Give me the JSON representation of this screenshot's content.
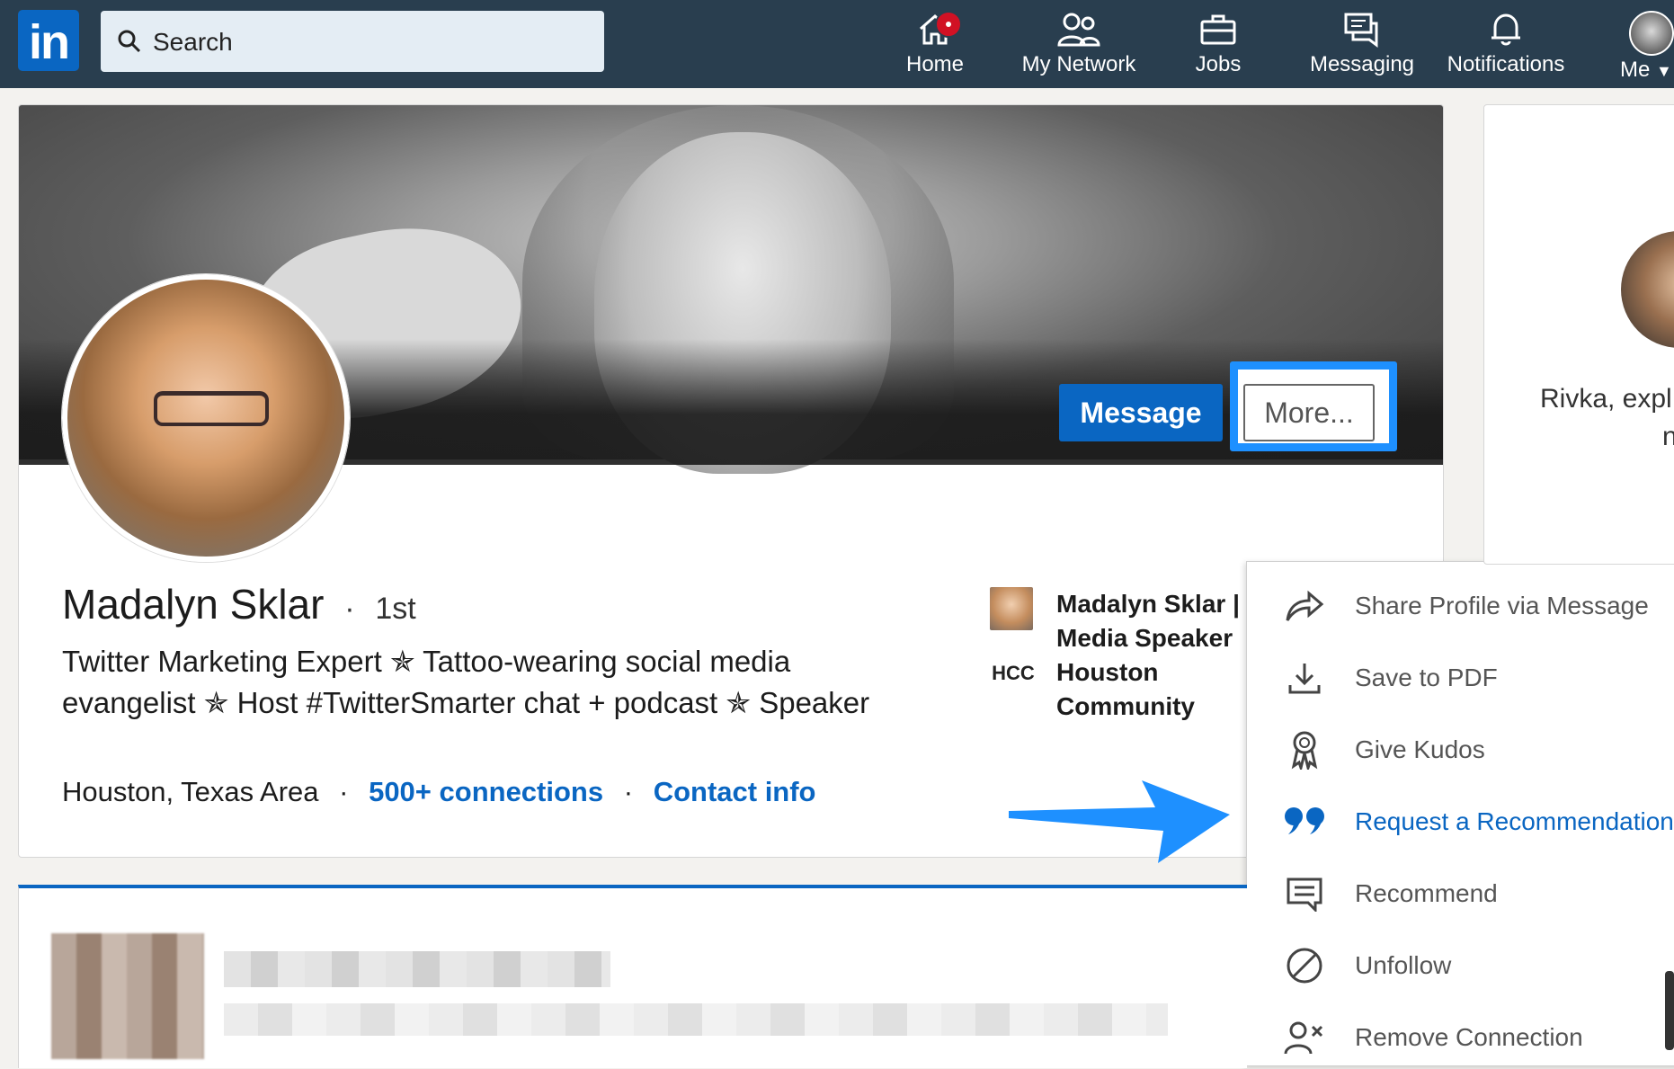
{
  "topbar": {
    "logo": "in",
    "search_placeholder": "Search",
    "nav": [
      {
        "label": "Home",
        "icon": "home-icon",
        "has_badge": true
      },
      {
        "label": "My Network",
        "icon": "network-icon"
      },
      {
        "label": "Jobs",
        "icon": "briefcase-icon"
      },
      {
        "label": "Messaging",
        "icon": "messaging-icon"
      },
      {
        "label": "Notifications",
        "icon": "bell-icon"
      },
      {
        "label": "Me",
        "icon": "avatar-icon"
      }
    ]
  },
  "profile": {
    "name": "Madalyn Sklar",
    "degree_separator": "·",
    "degree": "1st",
    "headline": "Twitter Marketing Expert ✯ Tattoo-wearing social media evangelist ✯ Host #TwitterSmarter chat + podcast ✯ Speaker",
    "location": "Houston, Texas Area",
    "meta_separator": "·",
    "connections": "500+ connections",
    "contact": "Contact info",
    "message_button": "Message",
    "more_button": "More...",
    "experience": [
      {
        "text": "Madalyn Sklar | Media Speaker &"
      },
      {
        "logo_text": "HCC",
        "text": "Houston Community College"
      }
    ]
  },
  "dropdown": {
    "items": [
      {
        "label": "Share Profile via Message",
        "icon": "share-arrow-icon"
      },
      {
        "label": "Save to PDF",
        "icon": "download-icon"
      },
      {
        "label": "Give Kudos",
        "icon": "ribbon-icon"
      },
      {
        "label": "Request a Recommendation",
        "icon": "quote-icon",
        "highlighted": true
      },
      {
        "label": "Recommend",
        "icon": "comment-icon"
      },
      {
        "label": "Unfollow",
        "icon": "block-icon"
      },
      {
        "label": "Remove Connection",
        "icon": "remove-person-icon"
      }
    ]
  },
  "right_card": {
    "line1": "Rivka, expl",
    "line2": "n"
  },
  "colors": {
    "topbar": "#293e4f",
    "brand_blue": "#0a66c2",
    "highlight": "#1e90ff"
  }
}
